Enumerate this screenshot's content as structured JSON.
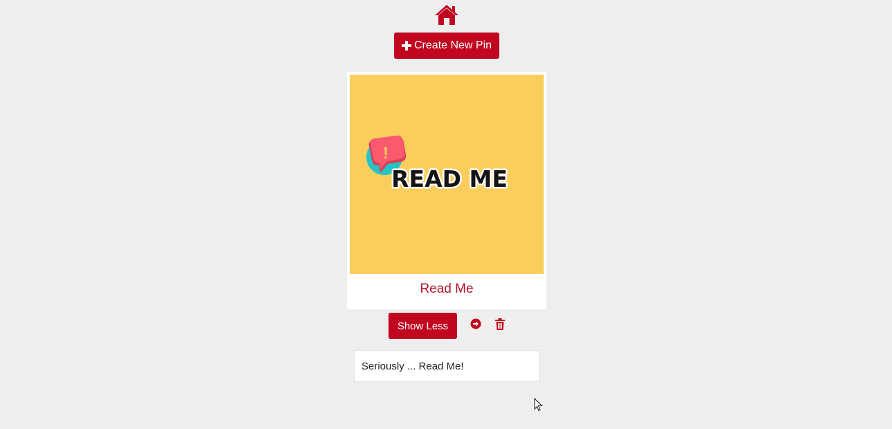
{
  "header": {
    "home_icon": "home-icon",
    "create_button_label": "Create New Pin",
    "create_button_icon": "plus-icon"
  },
  "pin": {
    "image_text": "READ ME",
    "image_alert_symbol": "!",
    "title": "Read Me",
    "show_less_label": "Show Less",
    "open_icon": "arrow-circle-right-icon",
    "delete_icon": "trash-icon",
    "description": "Seriously ... Read Me!"
  },
  "colors": {
    "background": "#eeeeee",
    "accent": "#c0071f",
    "title_text": "#b5122b",
    "image_background": "#f9ce5c",
    "bubble_pink": "#fb5a6e",
    "bubble_teal": "#25c5c7",
    "card": "#ffffff"
  }
}
